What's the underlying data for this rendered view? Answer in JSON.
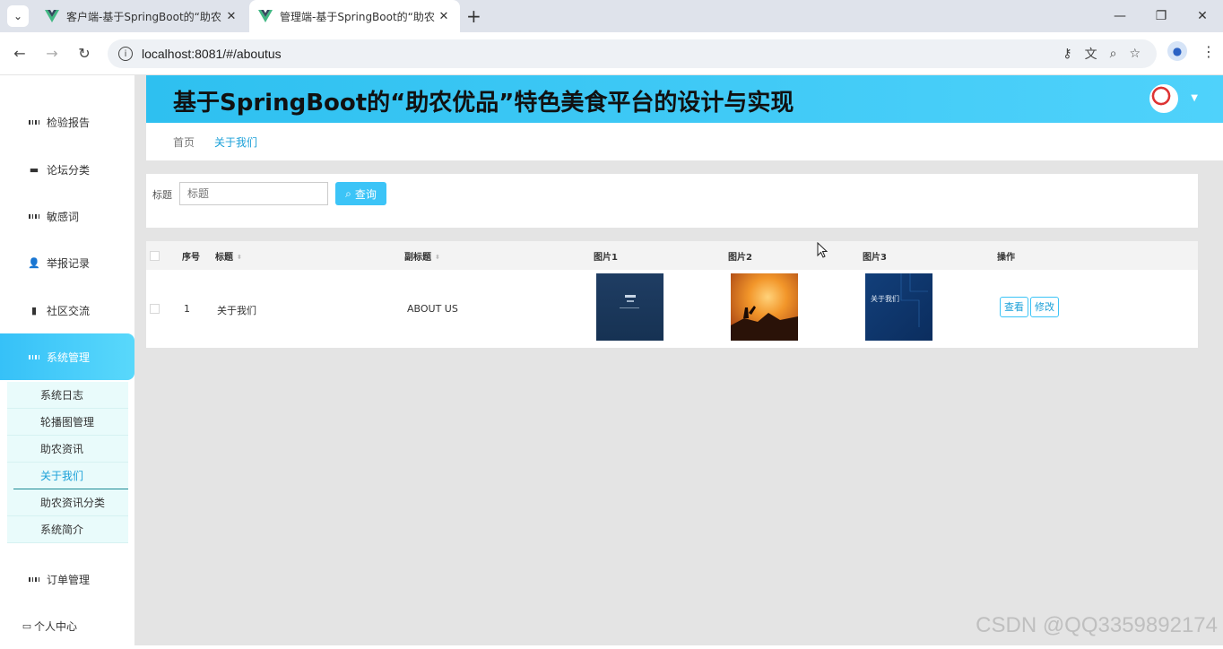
{
  "browser": {
    "tabs": [
      {
        "title": "客户端-基于SpringBoot的“助农",
        "active": false
      },
      {
        "title": "管理端-基于SpringBoot的“助农",
        "active": true
      }
    ],
    "url": "localhost:8081/#/aboutus"
  },
  "header": {
    "title": "基于SpringBoot的“助农优品”特色美食平台的设计与实现"
  },
  "breadcrumb": {
    "home": "首页",
    "current": "关于我们"
  },
  "sidebar": {
    "items": [
      {
        "label": "检验报告",
        "icon": "grid-icon"
      },
      {
        "label": "论坛分类",
        "icon": "briefcase-icon"
      },
      {
        "label": "敏感词",
        "icon": "grid-icon"
      },
      {
        "label": "举报记录",
        "icon": "user-icon"
      },
      {
        "label": "社区交流",
        "icon": "clipboard-icon"
      },
      {
        "label": "系统管理",
        "icon": "grid-icon",
        "active": true
      },
      {
        "label": "订单管理",
        "icon": "grid-icon"
      },
      {
        "label": "个人中心",
        "icon": "window-icon"
      }
    ],
    "submenu": [
      {
        "label": "系统日志"
      },
      {
        "label": "轮播图管理"
      },
      {
        "label": "助农资讯"
      },
      {
        "label": "关于我们",
        "active": true
      },
      {
        "label": "助农资讯分类"
      },
      {
        "label": "系统简介"
      }
    ]
  },
  "search": {
    "label": "标题",
    "placeholder": "标题",
    "button": "查询"
  },
  "table": {
    "headers": {
      "index": "序号",
      "title": "标题",
      "subtitle": "副标题",
      "img1": "图片1",
      "img2": "图片2",
      "img3": "图片3",
      "actions": "操作"
    },
    "rows": [
      {
        "index": "1",
        "title": "关于我们",
        "subtitle": "ABOUT US",
        "view": "查看",
        "edit": "修改",
        "img3_text": "关于我们"
      }
    ]
  },
  "watermark": "CSDN @QQ3359892174",
  "colors": {
    "accent": "#3cc4f7",
    "header_gradient_start": "#2ec0f0",
    "header_gradient_end": "#4fd2fb",
    "link": "#1ba0d8"
  }
}
